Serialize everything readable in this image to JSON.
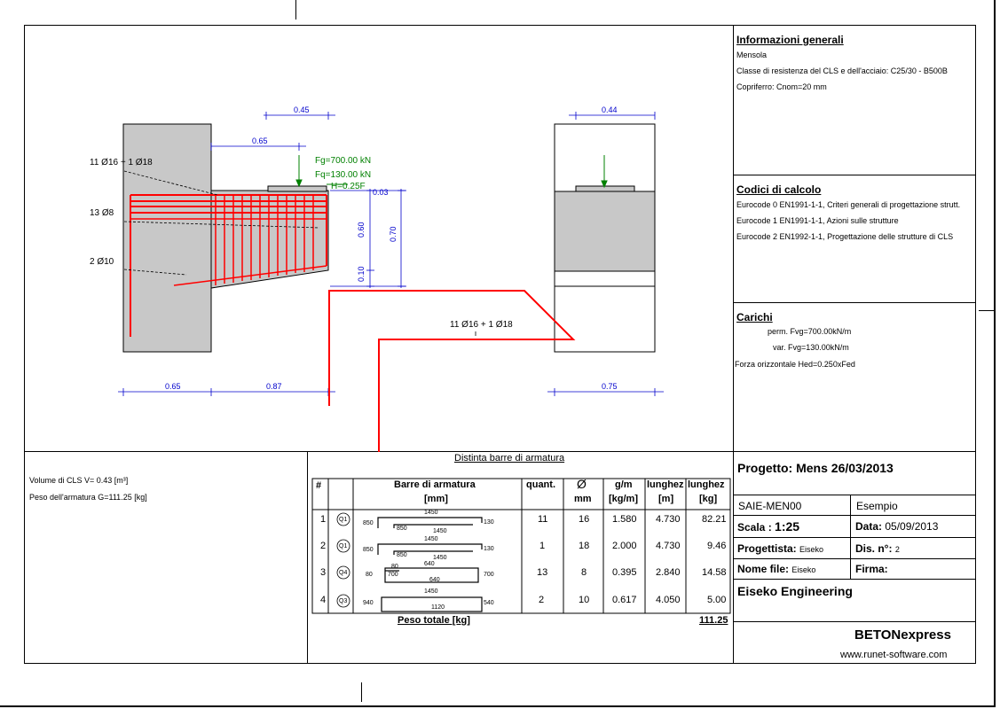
{
  "info": {
    "title": "Informazioni generali",
    "element": "Mensola",
    "classe": "Classe di resistenza del CLS e dell'acciaio: C25/30 - B500B",
    "copriferro": "Copriferro: Cnom=20 mm"
  },
  "codici": {
    "title": "Codici di calcolo",
    "lines": [
      "Eurocode 0 EN1991-1-1,  Criteri generali di progettazione strutt.",
      "Eurocode 1 EN1991-1-1,  Azioni sulle strutture",
      "Eurocode 2 EN1992-1-1,  Progettazione delle strutture di CLS"
    ]
  },
  "carichi": {
    "title": "Carichi",
    "perm": "perm.  Fvg=700.00kN/m",
    "var": "var.  Fvg=130.00kN/m",
    "hor": "Forza orizzontale Hed=0.250xFed"
  },
  "drawing": {
    "side": {
      "dim_045": "0.45",
      "dim_065_top": "0.65",
      "fg": "Fg=700.00 kN",
      "fq": "Fq=130.00 kN",
      "h": "H=0.25F",
      "dim_003": "0.03",
      "dim_060": "0.60",
      "dim_070": "0.70",
      "dim_010": "0.10",
      "label_top": "11 Ø16  +  1 Ø18",
      "label_mid": "13 Ø8",
      "label_bot": "2 Ø10",
      "dim_065_bot": "0.65",
      "dim_087": "0.87"
    },
    "front": {
      "dim_044": "0.44",
      "dim_075": "0.75"
    },
    "section_label": "11 Ø16  +  1 Ø18"
  },
  "volume": {
    "vol": "Volume di CLS  V=  0.43 [m³]",
    "peso": "Peso dell'armatura G=111.25 [kg]"
  },
  "distinta": {
    "title": "Distinta barre di armatura",
    "headers": {
      "num": "#",
      "barre": "Barre di armatura",
      "barre_unit": "[mm]",
      "quant": "quant.",
      "diam": "Ø",
      "diam_unit": "mm",
      "gm": "g/m",
      "gm_unit": "[kg/m]",
      "lung": "lunghez",
      "lung_unit": "[m]",
      "peso": "lunghez",
      "peso_unit": "[kg]"
    },
    "rows": [
      {
        "n": "1",
        "pos": "Q1",
        "quant": "11",
        "diam": "16",
        "gm": "1.580",
        "lung": "4.730",
        "kg": "82.21",
        "a": "850",
        "b": "1450",
        "c": "130",
        "d": "850",
        "e": "1450"
      },
      {
        "n": "2",
        "pos": "Q1",
        "quant": "1",
        "diam": "18",
        "gm": "2.000",
        "lung": "4.730",
        "kg": "9.46",
        "a": "850",
        "b": "1450",
        "c": "130",
        "d": "850",
        "e": "1450"
      },
      {
        "n": "3",
        "pos": "Q4",
        "quant": "13",
        "diam": "8",
        "gm": "0.395",
        "lung": "2.840",
        "kg": "14.58",
        "a": "80",
        "b": "640",
        "c": "700",
        "d": "80",
        "e": "700",
        "f": "640"
      },
      {
        "n": "4",
        "pos": "Q3",
        "quant": "2",
        "diam": "10",
        "gm": "0.617",
        "lung": "4.050",
        "kg": "5.00",
        "a": "940",
        "b": "1450",
        "c": "540",
        "d": "1120"
      }
    ],
    "total_label": "Peso totale  [kg]",
    "total_value": "111.25"
  },
  "cartiglio": {
    "progetto": "Progetto: Mens  26/03/2013",
    "code": "SAIE-MEN00",
    "esempio": "Esempio",
    "scala_label": "Scala : ",
    "scala_value": "1:25",
    "data_label": "Data: ",
    "data_value": "05/09/2013",
    "progettista_label": "Progettista: ",
    "progettista_value": "Eiseko",
    "dis_label": "Dis. n°: ",
    "dis_value": "2",
    "nomefile_label": "Nome file: ",
    "nomefile_value": "Eiseko",
    "firma": "Firma:",
    "company": "Eiseko Engineering",
    "product": "BETONexpress",
    "url": "www.runet-software.com"
  }
}
